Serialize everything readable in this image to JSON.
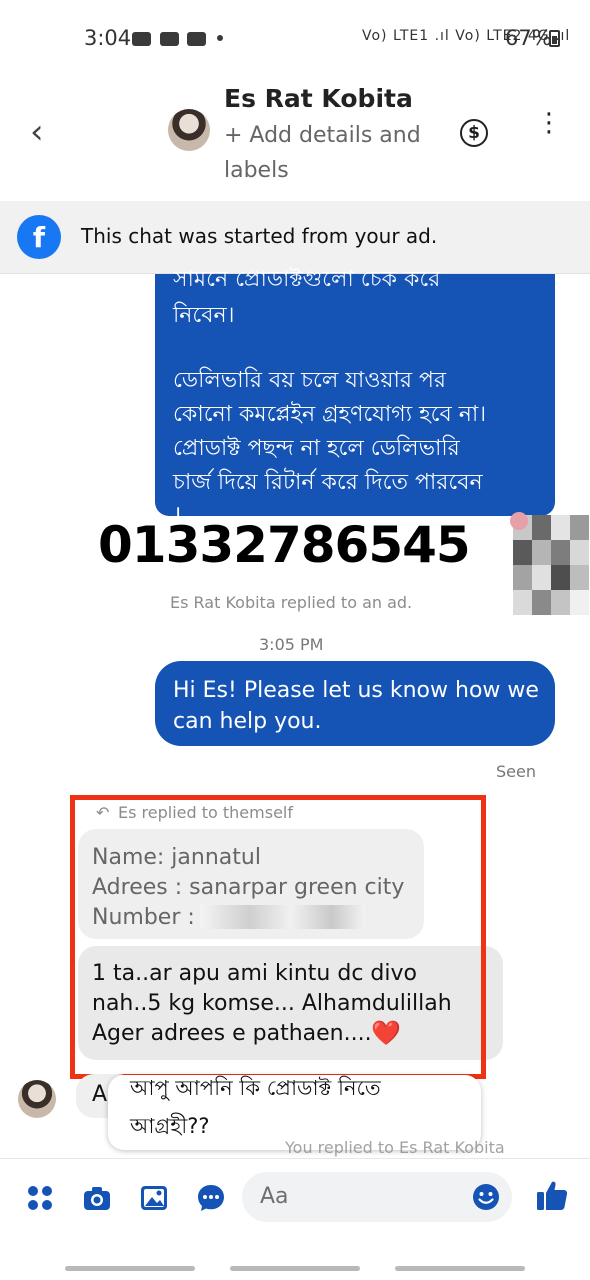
{
  "status_bar": {
    "time": "3:04",
    "net_text": "Vo) LTE1 .ıl Vo) LTE2 4G .ıl",
    "battery": "67%"
  },
  "header": {
    "contact_name": "Es Rat Kobita",
    "subtitle": "+ Add details and labels",
    "dollar_symbol": "$"
  },
  "ad_banner": {
    "text": "This chat was started from your ad."
  },
  "messages": {
    "sent_bengali_lines": [
      "সামনে প্রোডাক্টগুলো চেক করে",
      "নিবেন।",
      "ডেলিভারি বয় চলে যাওয়ার পর",
      "কোনো কমপ্লেইন গ্রহণযোগ্য হবে না।",
      "প্রোডাক্ট পছন্দ না হলে ডেলিভারি",
      "চার্জ দিয়ে রিটার্ন করে দিতে পারবেন",
      "।"
    ],
    "phone_overlay": "01332786545",
    "replied_to_ad": "Es Rat Kobita replied to an ad.",
    "timestamp": "3:05 PM",
    "sent_greeting": "Hi Es! Please let us know how we can help you.",
    "seen": "Seen",
    "replied_to_self": "Es replied to themself",
    "info_lines": [
      "Name: jannatul",
      "Adrees : sanarpar green city",
      "Number :"
    ],
    "customer_lines": [
      "1 ta..ar apu ami kintu dc divo",
      "nah..5 kg komse... Alhamdulillah",
      "Ager adrees e pathaen...."
    ],
    "heart": "❤️",
    "partial_reply_letter": "A",
    "quick_reply_lines": [
      "আপু আপনি কি প্রোডাক্ট নিতে",
      "আগ্রহী??"
    ],
    "you_replied_note": "You replied to Es Rat Kobita"
  },
  "composer": {
    "placeholder": "Aa"
  },
  "colors": {
    "messenger_blue": "#1553b5",
    "facebook_blue": "#1877f2",
    "highlight_red": "#f03214"
  },
  "icons": [
    "back-chevron-icon",
    "dollar-circle-icon",
    "more-vertical-icon",
    "facebook-icon",
    "apps-grid-icon",
    "camera-icon",
    "gallery-icon",
    "voice-chat-icon",
    "emoji-icon",
    "thumbs-up-icon"
  ]
}
